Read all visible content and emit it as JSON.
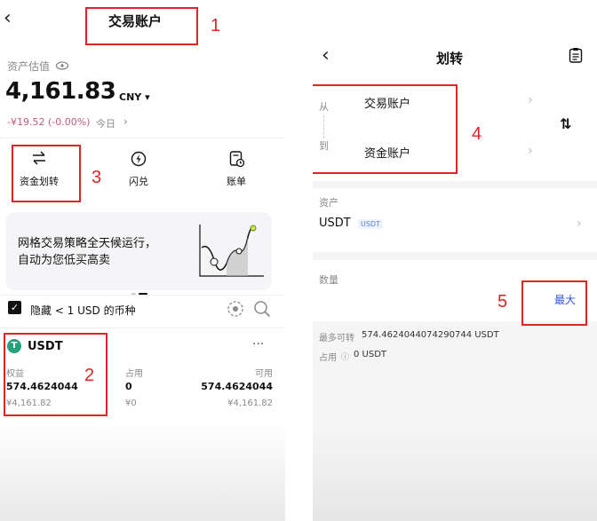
{
  "left": {
    "title": "交易账户",
    "assets_label": "资产估值",
    "balance": "4,161.83",
    "currency": "CNY ▾",
    "pnl": "-¥19.52 (-0.00%)",
    "pnl_period": "今日",
    "actions": [
      {
        "label": "资金划转"
      },
      {
        "label": "闪兑"
      },
      {
        "label": "账单"
      }
    ],
    "promo_text_1": "网格交易策略全天候运行，",
    "promo_text_2": "自动为您低买高卖",
    "hide_small": "隐藏 < 1 USD 的币种",
    "coin": {
      "name": "USDT",
      "icon_letter": "T",
      "equity_label": "权益",
      "equity": "574.4624044",
      "equity_cny": "¥4,161.82",
      "used_label": "占用",
      "used": "0",
      "used_cny": "¥0",
      "avail_label": "可用",
      "avail": "574.4624044",
      "avail_cny": "¥4,161.82",
      "more": "···"
    }
  },
  "right": {
    "title": "划转",
    "from_label": "从",
    "from_account": "交易账户",
    "to_label": "到",
    "to_account": "资金账户",
    "swap_icon": "⇅",
    "asset_label": "资产",
    "asset_value": "USDT",
    "asset_tag": "USDT",
    "qty_label": "数量",
    "max_label": "最大",
    "max_transfer_label": "最多可转",
    "max_transfer_value": "574.4624044074290744 USDT",
    "occupied_label": "占用",
    "occupied_value": "0 USDT"
  },
  "annotations": [
    "1",
    "2",
    "3",
    "4",
    "5"
  ],
  "colors": {
    "annotation": "#e02424",
    "accent_blue": "#2f54eb",
    "pnl_pink": "#c85a7a",
    "usdt_green": "#26a17b"
  }
}
